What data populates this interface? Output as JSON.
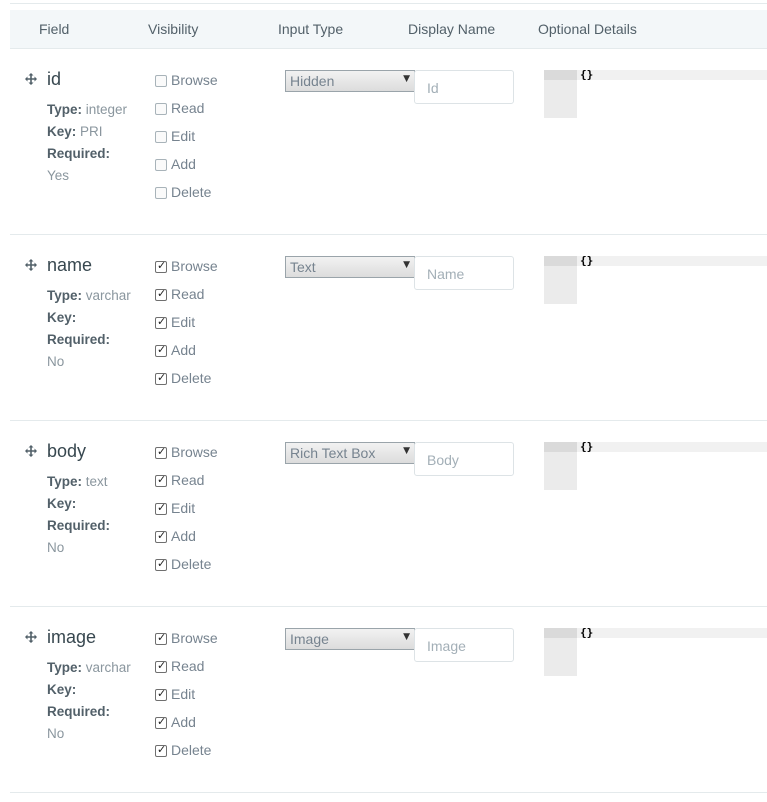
{
  "header": {
    "field": "Field",
    "visibility": "Visibility",
    "input_type": "Input Type",
    "display_name": "Display Name",
    "optional_details": "Optional Details"
  },
  "labels": {
    "type": "Type:",
    "key": "Key:",
    "required": "Required:"
  },
  "rows": [
    {
      "name": "id",
      "type_value": "integer",
      "key_value": "PRI",
      "required_value": "Yes",
      "visibility": [
        {
          "label": "Browse",
          "checked": false
        },
        {
          "label": "Read",
          "checked": false
        },
        {
          "label": "Edit",
          "checked": false
        },
        {
          "label": "Add",
          "checked": false
        },
        {
          "label": "Delete",
          "checked": false
        }
      ],
      "input_type": "Hidden",
      "display_placeholder": "Id",
      "details": "{}"
    },
    {
      "name": "name",
      "type_value": "varchar",
      "key_value": "",
      "required_value": "No",
      "visibility": [
        {
          "label": "Browse",
          "checked": true
        },
        {
          "label": "Read",
          "checked": true
        },
        {
          "label": "Edit",
          "checked": true
        },
        {
          "label": "Add",
          "checked": true
        },
        {
          "label": "Delete",
          "checked": true
        }
      ],
      "input_type": "Text",
      "display_placeholder": "Name",
      "details": "{}"
    },
    {
      "name": "body",
      "type_value": "text",
      "key_value": "",
      "required_value": "No",
      "visibility": [
        {
          "label": "Browse",
          "checked": true
        },
        {
          "label": "Read",
          "checked": true
        },
        {
          "label": "Edit",
          "checked": true
        },
        {
          "label": "Add",
          "checked": true
        },
        {
          "label": "Delete",
          "checked": true
        }
      ],
      "input_type": "Rich Text Box",
      "display_placeholder": "Body",
      "details": "{}"
    },
    {
      "name": "image",
      "type_value": "varchar",
      "key_value": "",
      "required_value": "No",
      "visibility": [
        {
          "label": "Browse",
          "checked": true
        },
        {
          "label": "Read",
          "checked": true
        },
        {
          "label": "Edit",
          "checked": true
        },
        {
          "label": "Add",
          "checked": true
        },
        {
          "label": "Delete",
          "checked": true
        }
      ],
      "input_type": "Image",
      "display_placeholder": "Image",
      "details": "{}"
    }
  ]
}
